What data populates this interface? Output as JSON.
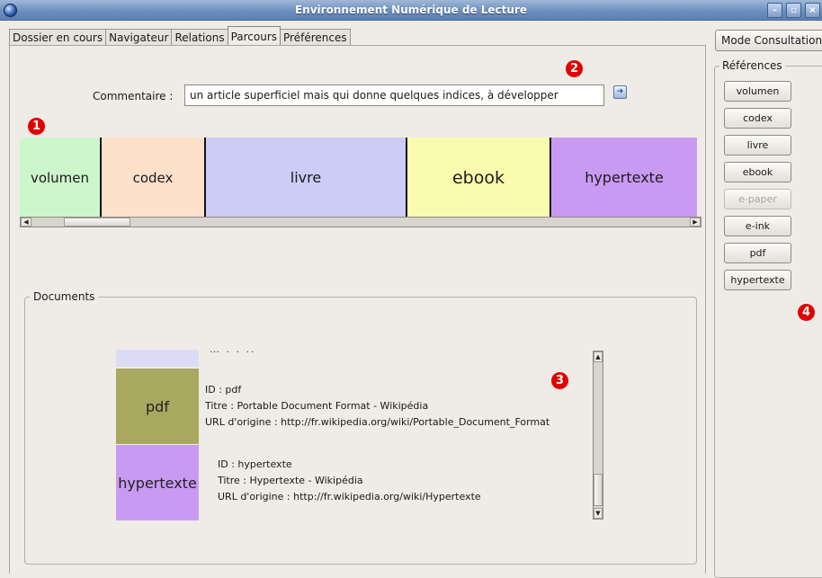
{
  "window": {
    "title": "Environnement Numérique de Lecture",
    "buttons": [
      "–",
      "▫",
      "×"
    ]
  },
  "tabs": [
    {
      "label": "Dossier en cours",
      "active": false
    },
    {
      "label": "Navigateur",
      "active": false
    },
    {
      "label": "Relations",
      "active": false
    },
    {
      "label": "Parcours",
      "active": true
    },
    {
      "label": "Préférences",
      "active": false
    }
  ],
  "comment": {
    "label": "Commentaire :",
    "value": "un article superficiel mais qui donne quelques indices, à développer",
    "icon": "info-icon"
  },
  "badges": [
    "1",
    "2",
    "3",
    "4"
  ],
  "parcours": [
    {
      "label": "volumen",
      "color": "#ccf7cc"
    },
    {
      "label": "codex",
      "color": "#fde1cb"
    },
    {
      "label": "livre",
      "color": "#ccccf6"
    },
    {
      "label": "ebook",
      "color": "#fbfbb0"
    },
    {
      "label": "hypertexte",
      "color": "#c99af2"
    }
  ],
  "documents": {
    "legend": "Documents",
    "items": [
      {
        "label": "pdf",
        "color": "#a9a860",
        "id": "ID : pdf",
        "title": "Titre : Portable Document Format - Wikipédia",
        "url": "URL d'origine : http://fr.wikipedia.org/wiki/Portable_Document_Format"
      },
      {
        "label": "hypertexte",
        "color": "#c99af2",
        "id": "ID : hypertexte",
        "title": "Titre : Hypertexte - Wikipédia",
        "url": "URL d'origine : http://fr.wikipedia.org/wiki/Hypertexte"
      }
    ]
  },
  "mode_button": "Mode Consultation",
  "references": {
    "legend": "Références",
    "items": [
      {
        "label": "volumen",
        "enabled": true
      },
      {
        "label": "codex",
        "enabled": true
      },
      {
        "label": "livre",
        "enabled": true
      },
      {
        "label": "ebook",
        "enabled": true
      },
      {
        "label": "e-paper",
        "enabled": false
      },
      {
        "label": "e-ink",
        "enabled": true
      },
      {
        "label": "pdf",
        "enabled": true
      },
      {
        "label": "hypertexte",
        "enabled": true
      }
    ]
  }
}
